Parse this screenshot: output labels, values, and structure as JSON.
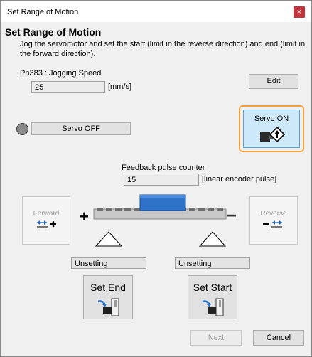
{
  "window": {
    "title": "Set Range of Motion",
    "close_icon": "close-icon"
  },
  "heading": "Set Range of Motion",
  "description": "Jog the servomotor and set the start (limit in the reverse direction) and end (limit in the forward direction).",
  "jog_speed": {
    "label": "Pn383 : Jogging Speed",
    "value": "25",
    "unit": "[mm/s]",
    "edit_label": "Edit"
  },
  "servo": {
    "off_label": "Servo OFF",
    "on_label": "Servo ON",
    "lamp_color": "#8a8a8a"
  },
  "feedback": {
    "label": "Feedback pulse counter",
    "value": "15",
    "unit": "[linear encoder pulse]"
  },
  "forward": {
    "label": "Forward",
    "plus": "+"
  },
  "reverse": {
    "label": "Reverse",
    "minus": "−"
  },
  "end_field": {
    "value": "Unsetting"
  },
  "start_field": {
    "value": "Unsetting"
  },
  "set_end": {
    "label": "Set End"
  },
  "set_start": {
    "label": "Set Start"
  },
  "footer": {
    "next_label": "Next",
    "cancel_label": "Cancel"
  },
  "colors": {
    "accent": "#f2a13a",
    "servo_on_bg": "#cce8f9",
    "slider_block": "#2f73c9",
    "close_red": "#c4343d"
  }
}
